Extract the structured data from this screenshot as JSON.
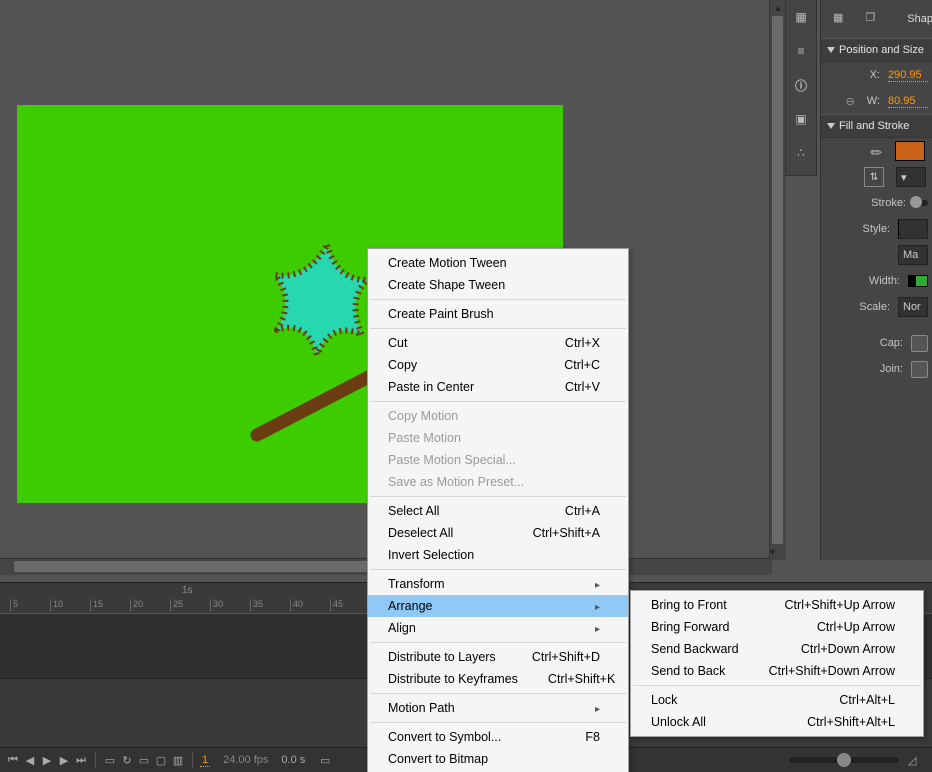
{
  "stage": {
    "bg": "#3CCC00"
  },
  "props": {
    "shape_label": "Shape",
    "sections": {
      "pos_size": "Position and Size",
      "fill_stroke": "Fill and Stroke"
    },
    "x_label": "X:",
    "x_value": "290.95",
    "w_label": "W:",
    "w_value": "80.95",
    "stroke_label": "Stroke:",
    "style_label": "Style:",
    "style_btn": "Ma",
    "width_label": "Width:",
    "scale_label": "Scale:",
    "scale_value": "Nor",
    "cap_label": "Cap:",
    "join_label": "Join:"
  },
  "timeline": {
    "sec_label": "1s",
    "ticks": [
      "5",
      "10",
      "15",
      "20",
      "25",
      "30",
      "35",
      "40",
      "45"
    ],
    "frame": "1",
    "fps": "24.00 fps",
    "elapsed": "0.0 s"
  },
  "context_menu": {
    "items": [
      {
        "label": "Create Motion Tween",
        "shortcut": ""
      },
      {
        "label": "Create Shape Tween",
        "shortcut": ""
      },
      {
        "sep": true
      },
      {
        "label": "Create Paint Brush",
        "shortcut": ""
      },
      {
        "sep": true
      },
      {
        "label": "Cut",
        "shortcut": "Ctrl+X"
      },
      {
        "label": "Copy",
        "shortcut": "Ctrl+C"
      },
      {
        "label": "Paste in Center",
        "shortcut": "Ctrl+V"
      },
      {
        "sep": true
      },
      {
        "label": "Copy Motion",
        "shortcut": "",
        "disabled": true
      },
      {
        "label": "Paste Motion",
        "shortcut": "",
        "disabled": true
      },
      {
        "label": "Paste Motion Special...",
        "shortcut": "",
        "disabled": true
      },
      {
        "label": "Save as Motion Preset...",
        "shortcut": "",
        "disabled": true
      },
      {
        "sep": true
      },
      {
        "label": "Select All",
        "shortcut": "Ctrl+A"
      },
      {
        "label": "Deselect All",
        "shortcut": "Ctrl+Shift+A"
      },
      {
        "label": "Invert Selection",
        "shortcut": ""
      },
      {
        "sep": true
      },
      {
        "label": "Transform",
        "shortcut": "",
        "submenu": true
      },
      {
        "label": "Arrange",
        "shortcut": "",
        "submenu": true,
        "highlight": true
      },
      {
        "label": "Align",
        "shortcut": "",
        "submenu": true
      },
      {
        "sep": true
      },
      {
        "label": "Distribute to Layers",
        "shortcut": "Ctrl+Shift+D"
      },
      {
        "label": "Distribute to Keyframes",
        "shortcut": "Ctrl+Shift+K"
      },
      {
        "sep": true
      },
      {
        "label": "Motion Path",
        "shortcut": "",
        "submenu": true
      },
      {
        "sep": true
      },
      {
        "label": "Convert to Symbol...",
        "shortcut": "F8"
      },
      {
        "label": "Convert to Bitmap",
        "shortcut": ""
      }
    ]
  },
  "arrange_menu": {
    "items": [
      {
        "label": "Bring to Front",
        "shortcut": "Ctrl+Shift+Up Arrow"
      },
      {
        "label": "Bring Forward",
        "shortcut": "Ctrl+Up Arrow"
      },
      {
        "label": "Send Backward",
        "shortcut": "Ctrl+Down Arrow"
      },
      {
        "label": "Send to Back",
        "shortcut": "Ctrl+Shift+Down Arrow"
      },
      {
        "sep": true
      },
      {
        "label": "Lock",
        "shortcut": "Ctrl+Alt+L"
      },
      {
        "label": "Unlock All",
        "shortcut": "Ctrl+Shift+Alt+L"
      }
    ]
  }
}
